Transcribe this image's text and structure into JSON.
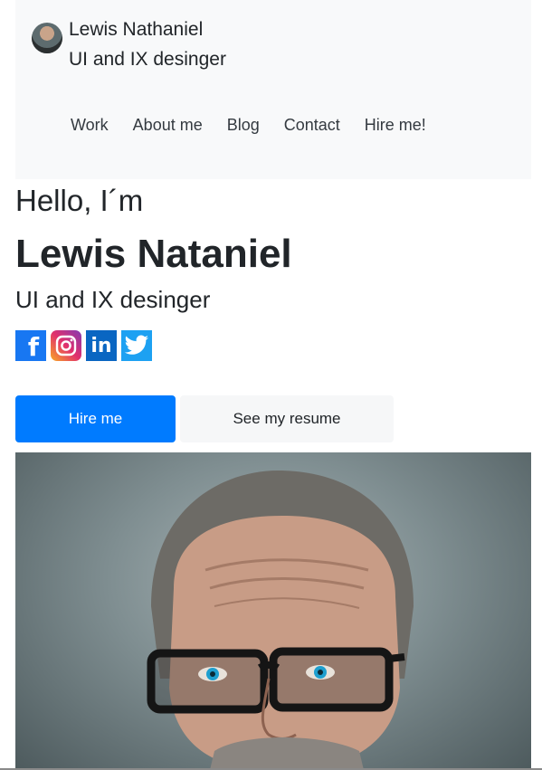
{
  "brand": {
    "name": "Lewis Nathaniel",
    "tagline": "UI and IX desinger"
  },
  "nav": {
    "items": [
      "Work",
      "About me",
      "Blog",
      "Contact",
      "Hire me!"
    ]
  },
  "hero": {
    "greeting": "Hello, I´m",
    "name": "Lewis Nataniel",
    "role": "UI and IX desinger"
  },
  "social": {
    "icons": [
      "facebook-icon",
      "instagram-icon",
      "linkedin-icon",
      "twitter-icon"
    ],
    "facebook_glyph": "f",
    "linkedin_glyph": "in"
  },
  "buttons": {
    "hire": "Hire me",
    "resume": "See my resume"
  },
  "colors": {
    "primary": "#007bff",
    "header_bg": "#f8f9fa",
    "secondary_bg": "#f6f7f8"
  }
}
